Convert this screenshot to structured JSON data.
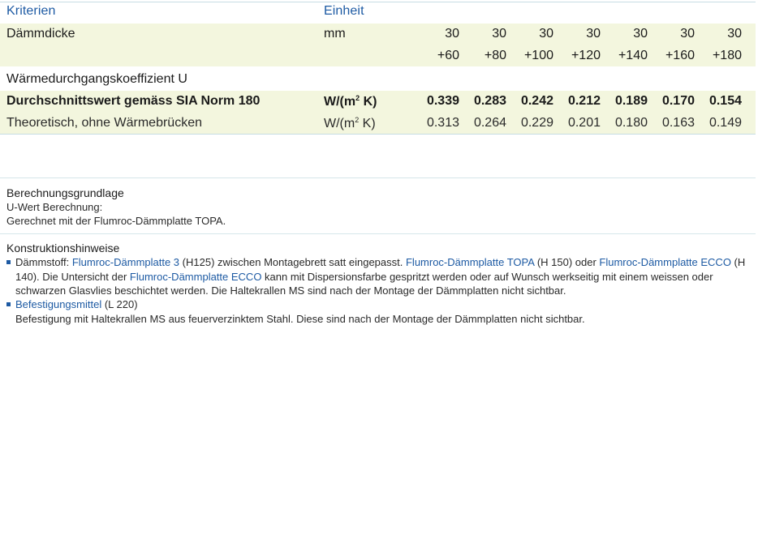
{
  "header": {
    "criteria": "Kriterien",
    "unit": "Einheit"
  },
  "columns": [
    {
      "top": "30",
      "bottom": "+60"
    },
    {
      "top": "30",
      "bottom": "+80"
    },
    {
      "top": "30",
      "bottom": "+100"
    },
    {
      "top": "30",
      "bottom": "+120"
    },
    {
      "top": "30",
      "bottom": "+140"
    },
    {
      "top": "30",
      "bottom": "+160"
    },
    {
      "top": "30",
      "bottom": "+180"
    }
  ],
  "rows": {
    "thickness": {
      "label": "Dämmdicke",
      "unit": "mm"
    },
    "u_heading": {
      "label": "Wärmedurchgangskoeffizient U"
    },
    "average": {
      "label": "Durchschnittswert gemäss SIA Norm 180",
      "unit_base": "W/(m",
      "unit_exp": "2",
      "unit_tail": " K)",
      "values": [
        "0.339",
        "0.283",
        "0.242",
        "0.212",
        "0.189",
        "0.170",
        "0.154"
      ]
    },
    "theoretical": {
      "label": "Theoretisch, ohne Wärmebrücken",
      "unit_base": "W/(m",
      "unit_exp": "2",
      "unit_tail": " K)",
      "values": [
        "0.313",
        "0.264",
        "0.229",
        "0.201",
        "0.180",
        "0.163",
        "0.149"
      ]
    }
  },
  "basis": {
    "title": "Berechnungsgrundlage",
    "line1": "U-Wert Berechnung:",
    "line2": "Gerechnet mit der Flumroc-Dämmplatte TOPA."
  },
  "construction": {
    "title": "Konstruktionshinweise",
    "item1": {
      "t1": "Dämmstoff: ",
      "l1": "Flumroc-Dämmplatte 3",
      "t2": " (H125) zwischen Montagebrett satt eingepasst. ",
      "l2": "Flumroc-Dämmplatte TOPA",
      "t3": " (H 150) oder ",
      "l3": "Flumroc-Dämmplatte ECCO",
      "t4": " (H 140). Die Untersicht der ",
      "l4": "Flumroc-Dämmplatte ECCO",
      "t5": " kann mit Dispersionsfarbe gespritzt werden oder auf Wunsch werkseitig mit einem weissen oder schwarzen Glasvlies beschichtet werden. Die Haltekrallen MS sind nach der Montage der Dämmplatten nicht sichtbar."
    },
    "item2": {
      "l1": "Befestigungsmittel",
      "t1": " (L 220)",
      "t2": "Befestigung mit Haltekrallen MS aus feuerverzinktem Stahl. Diese sind nach der Montage der Dämmplatten nicht sichtbar."
    }
  }
}
